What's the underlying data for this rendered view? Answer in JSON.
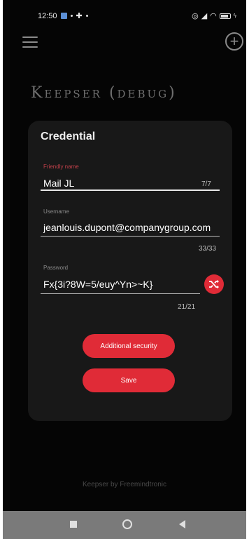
{
  "status_bar": {
    "time": "12:50"
  },
  "app": {
    "title": "Keepser (debug)",
    "accent_color": "#e02b37"
  },
  "card": {
    "title": "Credential",
    "fields": {
      "name": {
        "label": "Friendly name",
        "value": "Mail JL",
        "counter": "7/7"
      },
      "username": {
        "label": "Username",
        "value": "jeanlouis.dupont@companygroup.com",
        "counter": "33/33"
      },
      "password": {
        "label": "Password",
        "value": "Fx{3i?8W=5/euy^Yn>~K}",
        "counter": "21/21"
      }
    },
    "buttons": {
      "additional_security": "Additional security",
      "save": "Save"
    }
  },
  "footer": {
    "text": "Keepser by Freemindtronic"
  },
  "icons": {
    "menu": "hamburger-menu-icon",
    "add": "add-circle-icon",
    "shuffle": "shuffle-icon",
    "nav_recent": "square-icon",
    "nav_home": "circle-icon",
    "nav_back": "triangle-back-icon"
  }
}
